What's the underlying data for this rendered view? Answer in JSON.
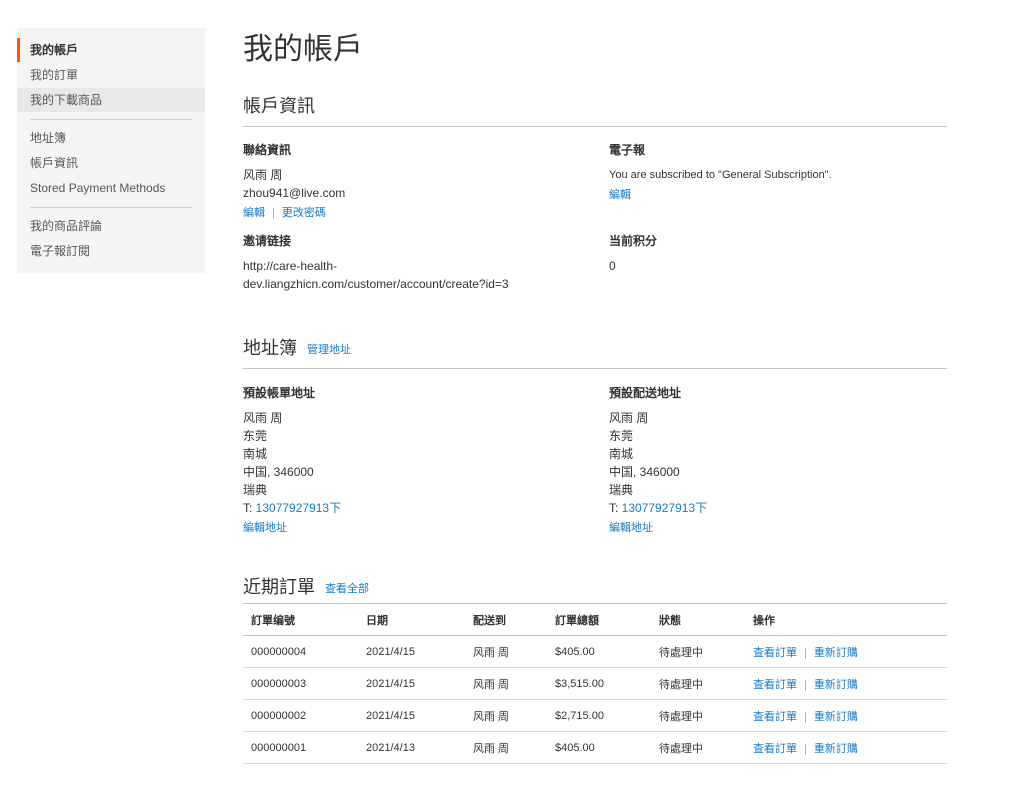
{
  "sidebar": {
    "items": [
      {
        "label": "我的帳戶"
      },
      {
        "label": "我的訂單"
      },
      {
        "label": "我的下載商品"
      },
      {
        "label": "地址簿"
      },
      {
        "label": "帳戶資訊"
      },
      {
        "label": "Stored Payment Methods"
      },
      {
        "label": "我的商品評論"
      },
      {
        "label": "電子報訂閱"
      }
    ]
  },
  "page": {
    "title": "我的帳戶"
  },
  "account_info": {
    "title": "帳戶資訊",
    "contact": {
      "title": "聯絡資訊",
      "name": "风雨 周",
      "email": "zhou941@live.com",
      "edit_label": "編輯",
      "change_password_label": "更改密碼"
    },
    "newsletter": {
      "title": "電子報",
      "text": "You are subscribed to \"General Subscription\".",
      "edit_label": "編輯"
    },
    "invite": {
      "title": "邀请链接",
      "line1": "http://care-health-",
      "line2": "dev.liangzhicn.com/customer/account/create?id=3"
    },
    "points": {
      "title": "当前积分",
      "value": "0"
    }
  },
  "address_book": {
    "title": "地址簿",
    "manage_label": "管理地址",
    "billing": {
      "title": "預設帳單地址",
      "name": "风雨 周",
      "city": "东莞",
      "street": "南城",
      "country_zip": "中国, 346000",
      "region": "瑞典",
      "phone_prefix": "T: ",
      "phone": "13077927913下",
      "edit_label": "編輯地址"
    },
    "shipping": {
      "title": "預設配送地址",
      "name": "风雨 周",
      "city": "东莞",
      "street": "南城",
      "country_zip": "中国, 346000",
      "region": "瑞典",
      "phone_prefix": "T: ",
      "phone": "13077927913下",
      "edit_label": "編輯地址"
    }
  },
  "recent_orders": {
    "title": "近期訂單",
    "view_all_label": "查看全部",
    "columns": [
      "訂單编號",
      "日期",
      "配送到",
      "訂單總額",
      "狀態",
      "操作"
    ],
    "view_label": "查看訂單",
    "reorder_label": "重新訂購",
    "rows": [
      {
        "id": "000000004",
        "date": "2021/4/15",
        "ship_to": "风雨 周",
        "total": "$405.00",
        "status": "待處理中"
      },
      {
        "id": "000000003",
        "date": "2021/4/15",
        "ship_to": "风雨 周",
        "total": "$3,515.00",
        "status": "待處理中"
      },
      {
        "id": "000000002",
        "date": "2021/4/15",
        "ship_to": "风雨 周",
        "total": "$2,715.00",
        "status": "待處理中"
      },
      {
        "id": "000000001",
        "date": "2021/4/13",
        "ship_to": "风雨 周",
        "total": "$405.00",
        "status": "待處理中"
      }
    ]
  }
}
